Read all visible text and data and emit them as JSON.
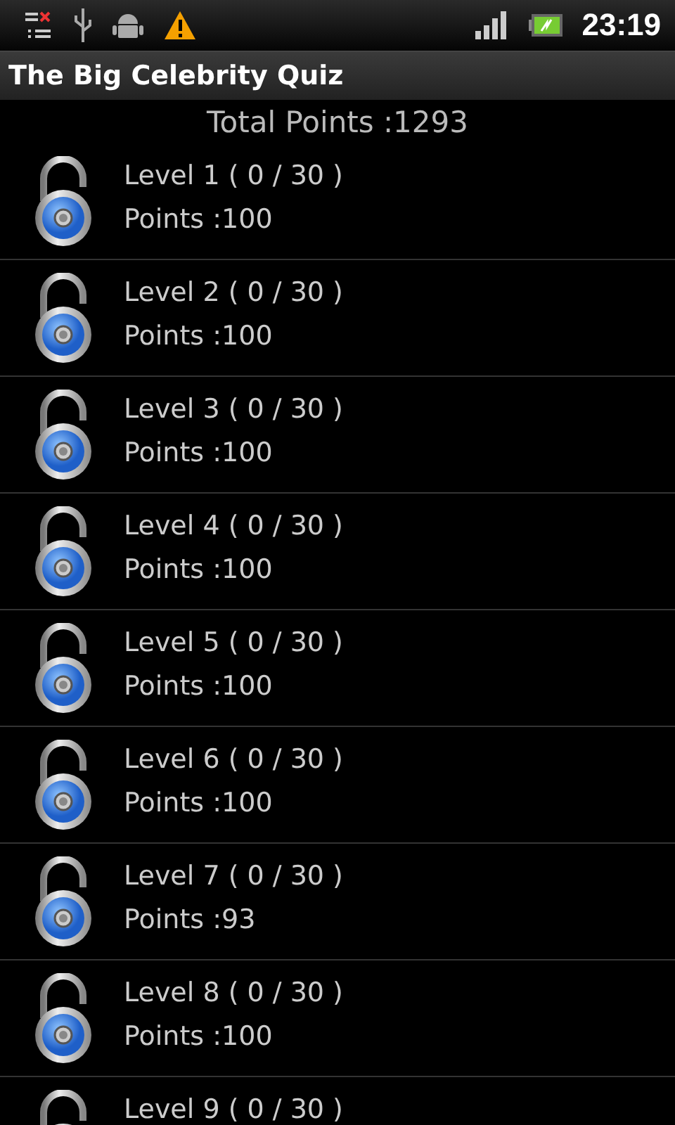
{
  "status_bar": {
    "time": "23:19"
  },
  "title": "The Big Celebrity Quiz",
  "total": "Total Points :1293",
  "levels": [
    {
      "title": "Level 1 ( 0 / 30 )",
      "points": "Points :100"
    },
    {
      "title": "Level 2 ( 0 / 30 )",
      "points": "Points :100"
    },
    {
      "title": "Level 3 ( 0 / 30 )",
      "points": "Points :100"
    },
    {
      "title": "Level 4 ( 0 / 30 )",
      "points": "Points :100"
    },
    {
      "title": "Level 5 ( 0 / 30 )",
      "points": "Points :100"
    },
    {
      "title": "Level 6 ( 0 / 30 )",
      "points": "Points :100"
    },
    {
      "title": "Level 7 ( 0 / 30 )",
      "points": "Points :93"
    },
    {
      "title": "Level 8 ( 0 / 30 )",
      "points": "Points :100"
    },
    {
      "title": "Level 9 ( 0 / 30 )"
    }
  ]
}
